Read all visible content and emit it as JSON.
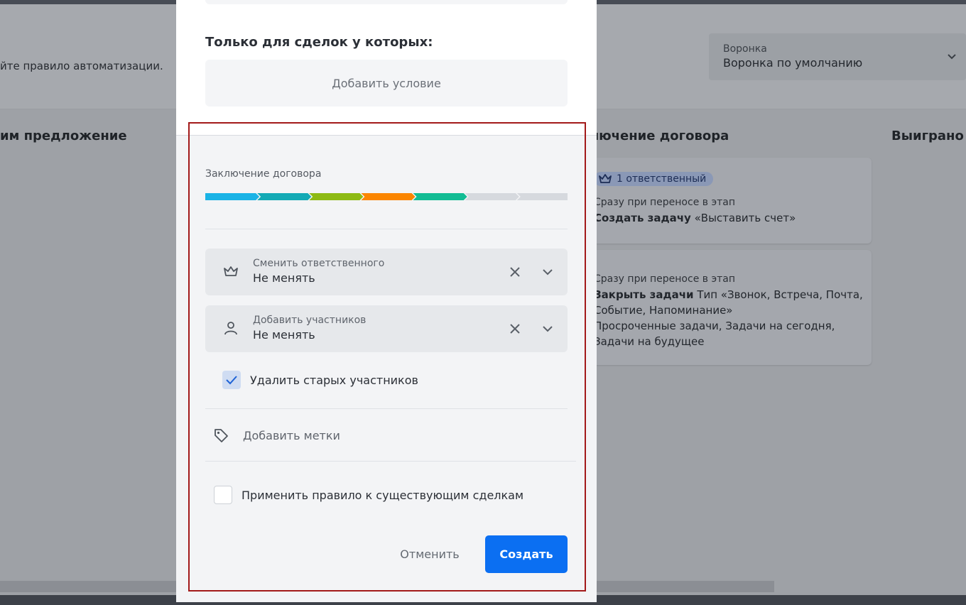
{
  "background": {
    "description_fragment": "йте правило автоматизации.",
    "funnel": {
      "label": "Воронка",
      "value": "Воронка по умолчанию"
    },
    "columns": [
      {
        "title": "им предложение"
      },
      {
        "title": "лючение договора"
      },
      {
        "title": "Выиграно"
      }
    ],
    "card1": {
      "badge": "1 ответственный",
      "trigger": "Сразу при переносе в этап",
      "action_bold": "Создать задачу",
      "action_rest": " «Выставить счет»"
    },
    "card2": {
      "trigger": "Сразу при переносе в этап",
      "action_bold": "Закрыть задачи",
      "action_rest": " Тип «Звонок, Встреча, Почта,",
      "line2": "Событие, Напоминание»",
      "line3": "Просроченные задачи, Задачи на сегодня,",
      "line4": "Задачи на будущее"
    }
  },
  "modal": {
    "conditions_title": "Только для сделок у которых:",
    "add_condition": "Добавить условие",
    "stage_label": "Заключение договора",
    "pipeline": {
      "colors": [
        "#1ab3e6",
        "#13aab5",
        "#8dba14",
        "#fb8500",
        "#12bc94",
        "#d6d9de",
        "#d6d9de"
      ],
      "completed_segments": 5,
      "total_segments": 7
    },
    "responsible": {
      "label": "Сменить ответственного",
      "value": "Не менять",
      "icon": "crown-icon"
    },
    "participants": {
      "label": "Добавить участников",
      "value": "Не менять",
      "icon": "user-icon"
    },
    "remove_old": {
      "label": "Удалить старых участников",
      "checked": true
    },
    "tags": {
      "label": "Добавить метки",
      "icon": "tag-icon"
    },
    "apply_existing": {
      "label": "Применить правило к существующим сделкам",
      "checked": false
    },
    "cancel": "Отменить",
    "create": "Создать"
  },
  "colors": {
    "accent": "#0b6ff2",
    "highlight_border": "#a31a1a"
  }
}
